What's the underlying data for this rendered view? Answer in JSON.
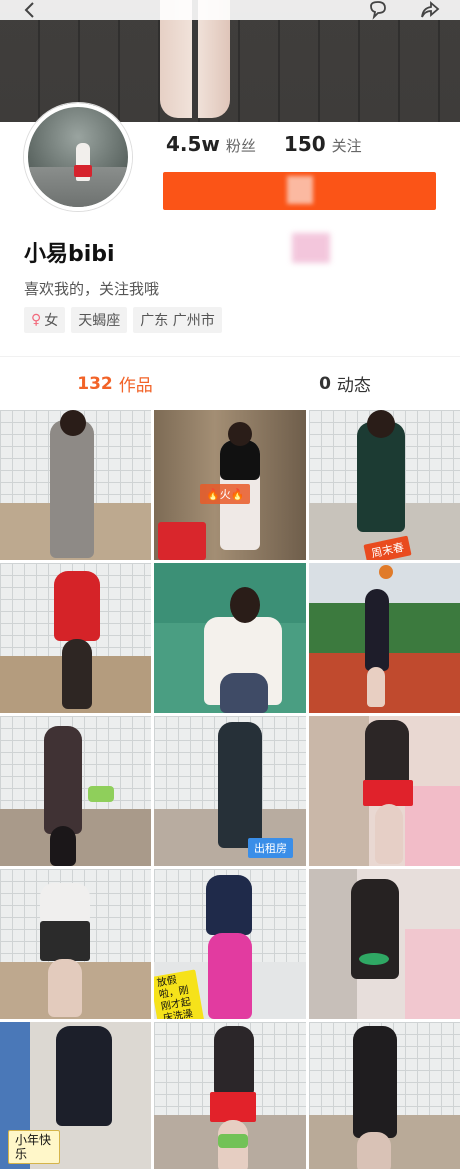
{
  "header": {
    "back_icon": "chevron-left-icon",
    "chat_icon": "chat-bubble-icon",
    "share_icon": "share-icon"
  },
  "profile": {
    "followers_count": "4.5w",
    "followers_label": "粉丝",
    "following_count": "150",
    "following_label": "关注",
    "name": "小易bibi",
    "bio": "喜欢我的，关注我哦",
    "tags": [
      {
        "icon": "female-icon",
        "label": "女"
      },
      {
        "icon": "",
        "label": "天蝎座"
      },
      {
        "icon": "",
        "label": "广东 广州市"
      }
    ]
  },
  "tabs": [
    {
      "count": "132",
      "label": "作品",
      "active": true
    },
    {
      "count": "0",
      "label": "动态",
      "active": false
    }
  ],
  "grid": {
    "labels": {
      "fire": "🔥火🔥",
      "weekend": "周末春",
      "rent": "出租房",
      "sticker": "放假啦，刚刚才起床洗澡",
      "new_year": "小年快乐"
    }
  },
  "colors": {
    "accent": "#fb5417",
    "active_tab": "#f26328"
  }
}
